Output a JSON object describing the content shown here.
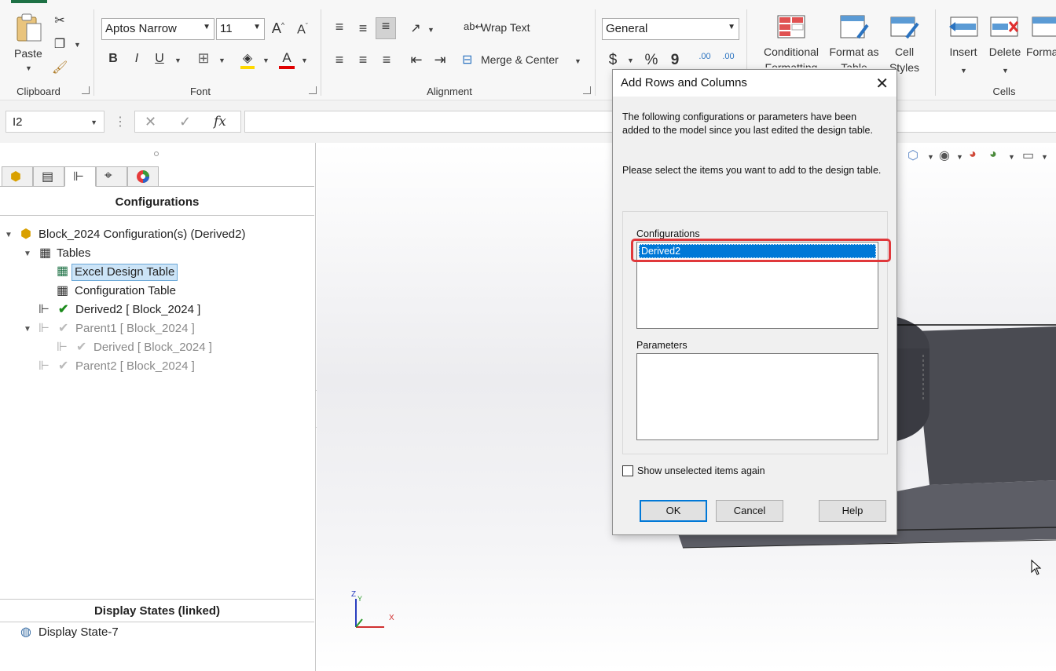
{
  "ribbon": {
    "clipboard": {
      "paste": "Paste",
      "group": "Clipboard"
    },
    "font": {
      "family": "Aptos Narrow",
      "size": "11",
      "bold": "B",
      "italic": "I",
      "underline": "U",
      "font_color": "A",
      "group": "Font"
    },
    "alignment": {
      "wrap": "Wrap Text",
      "merge": "Merge & Center",
      "group": "Alignment"
    },
    "number": {
      "format": "General",
      "currency": "$",
      "percent": "%",
      "comma": "9",
      "inc_dec": ".00"
    },
    "styles": {
      "conditional_1": "Conditional",
      "conditional_2": "Formatting",
      "format_table_1": "Format as",
      "format_table_2": "Table",
      "cell_styles_1": "Cell",
      "cell_styles_2": "Styles"
    },
    "cells": {
      "insert": "Insert",
      "delete": "Delete",
      "format": "Format",
      "group": "Cells"
    }
  },
  "formula_bar": {
    "name_box": "I2",
    "fx": "fx",
    "value": ""
  },
  "left_panel": {
    "heading": "Configurations",
    "tree": {
      "root": "Block_2024 Configuration(s)  (Derived2)",
      "tables": "Tables",
      "excel_table": "Excel Design Table",
      "config_table": "Configuration Table",
      "derived2": "Derived2 [ Block_2024 ]",
      "parent1": "Parent1 [ Block_2024 ]",
      "derived": "Derived [ Block_2024 ]",
      "parent2": "Parent2 [ Block_2024 ]"
    },
    "display_heading": "Display States (linked)",
    "display_state": "Display State-7"
  },
  "viewport": {
    "axis_z": "Z",
    "axis_y": "Y",
    "axis_x": "X"
  },
  "dialog": {
    "title": "Add Rows and Columns",
    "message1": "The following configurations or parameters have been added to the model since you last edited the design table.",
    "message2": "Please select the items you want to add to the design table.",
    "configurations_label": "Configurations",
    "configurations": [
      "Derived2"
    ],
    "parameters_label": "Parameters",
    "show_unselected": "Show unselected items again",
    "ok": "OK",
    "cancel": "Cancel",
    "help": "Help",
    "colors": {
      "selection": "#0078d7",
      "highlight": "#e0383b"
    }
  }
}
